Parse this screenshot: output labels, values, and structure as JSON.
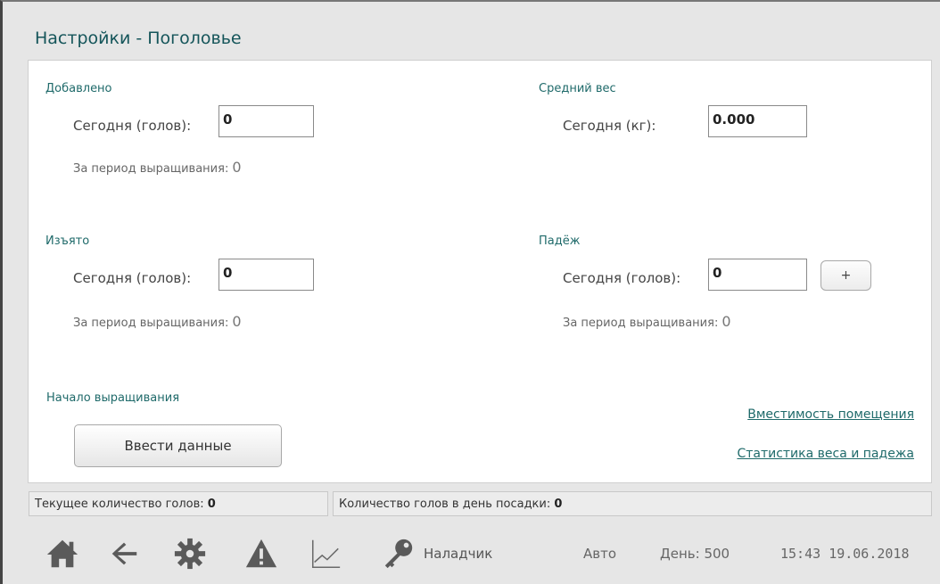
{
  "page": {
    "title": "Настройки - Поголовье"
  },
  "added": {
    "title": "Добавлено",
    "today_label": "Сегодня (голов):",
    "today_value": "0",
    "period_label": "За период выращивания:",
    "period_value": "0"
  },
  "avg_weight": {
    "title": "Средний вес",
    "today_label": "Сегодня (кг):",
    "today_value": "0.000"
  },
  "removed": {
    "title": "Изъято",
    "today_label": "Сегодня (голов):",
    "today_value": "0",
    "period_label": "За период выращивания:",
    "period_value": "0"
  },
  "mortality": {
    "title": "Падёж",
    "today_label": "Сегодня (голов):",
    "today_value": "0",
    "plus_label": "+",
    "period_label": "За период выращивания:",
    "period_value": "0"
  },
  "growing_start": {
    "title": "Начало выращивания",
    "button_label": "Ввести данные"
  },
  "links": {
    "capacity": "Вместимость помещения",
    "stats": "Статистика веса и падежа"
  },
  "status": {
    "current_label": "Текущее количество голов:",
    "current_value": "0",
    "placement_label": "Количество голов в день посадки:",
    "placement_value": "0"
  },
  "bottom_bar": {
    "icons": [
      "home-icon",
      "back-arrow-icon",
      "gear-icon",
      "warning-icon",
      "chart-icon",
      "key-icon"
    ],
    "user_label": "Наладчик",
    "mode": "Авто",
    "day_label": "День:",
    "day_value": "500",
    "time": "15:43",
    "date": "19.06.2018"
  },
  "colors": {
    "accent": "#1f6a6a",
    "icon": "#5a5a5a",
    "background": "#e6e6e6"
  }
}
